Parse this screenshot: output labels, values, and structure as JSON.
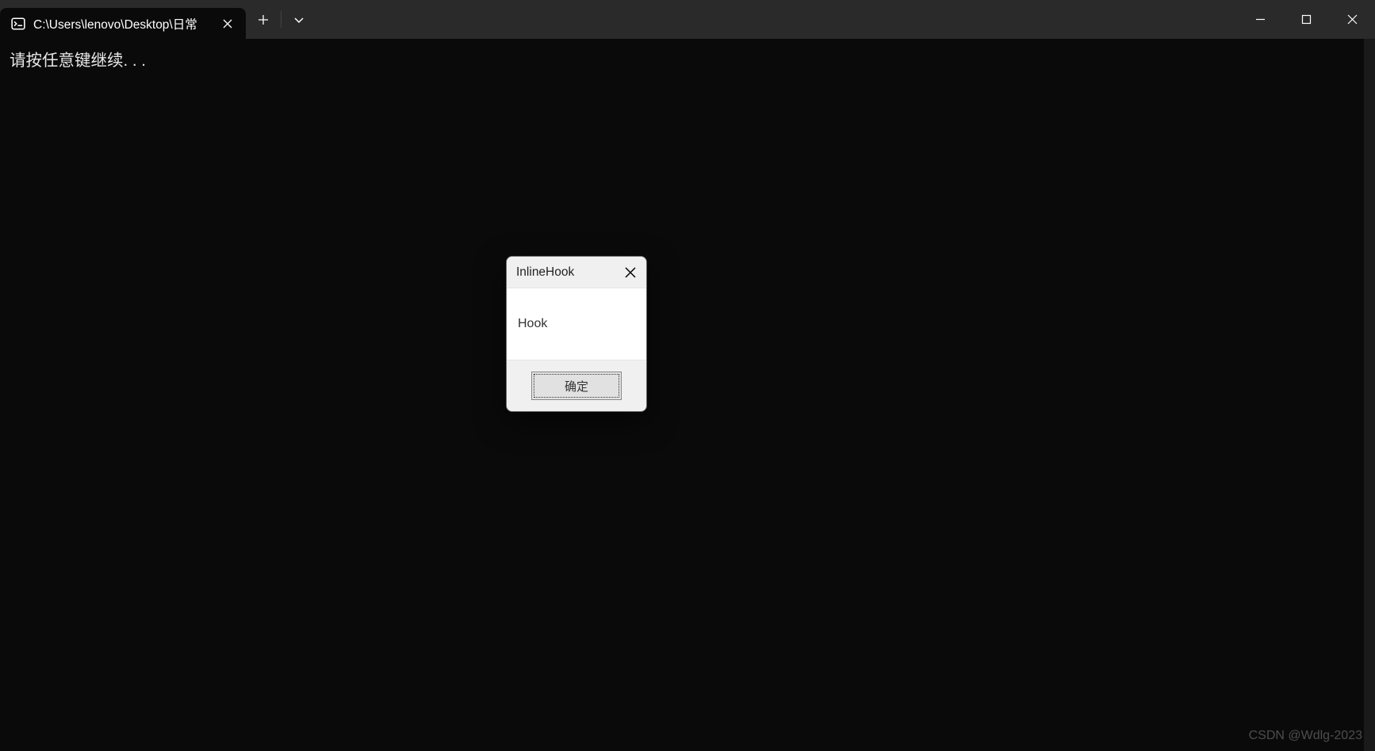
{
  "tab": {
    "title": "C:\\Users\\lenovo\\Desktop\\日常"
  },
  "console": {
    "output": "请按任意键继续. . ."
  },
  "dialog": {
    "title": "InlineHook",
    "message": "Hook",
    "ok_label": "确定"
  },
  "watermark": "CSDN @Wdlg-2023"
}
